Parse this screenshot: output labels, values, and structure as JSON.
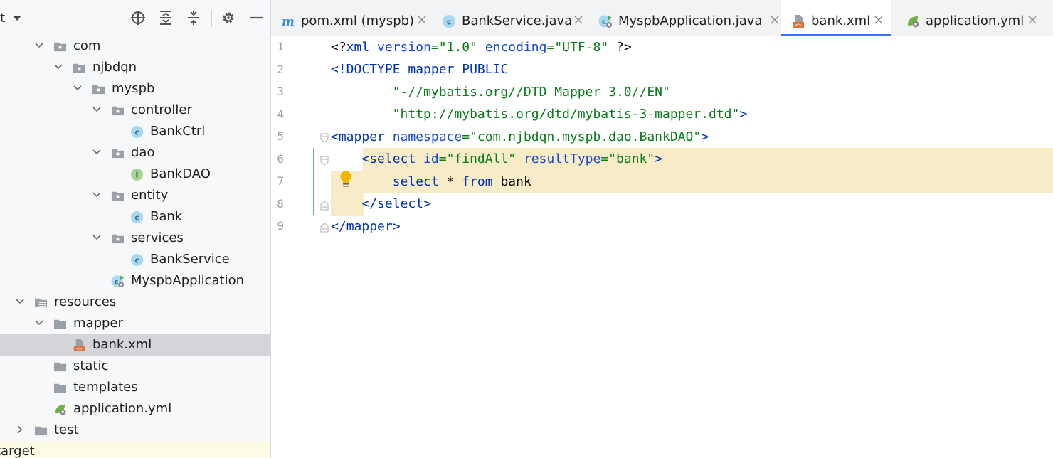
{
  "project_panel": {
    "title_fragment": "t",
    "toolbar": {
      "locate_icon": "crosshair-icon",
      "expand_icon": "expand-all-icon",
      "collapse_icon": "collapse-all-icon",
      "settings_icon": "gear-icon",
      "hide_icon": "minimize-icon"
    },
    "tree": [
      {
        "label": "com",
        "icon": "package-folder-icon"
      },
      {
        "label": "njbdqn",
        "icon": "package-folder-icon"
      },
      {
        "label": "myspb",
        "icon": "package-folder-icon"
      },
      {
        "label": "controller",
        "icon": "package-folder-icon"
      },
      {
        "label": "BankCtrl",
        "icon": "class-icon"
      },
      {
        "label": "dao",
        "icon": "package-folder-icon"
      },
      {
        "label": "BankDAO",
        "icon": "interface-icon"
      },
      {
        "label": "entity",
        "icon": "package-folder-icon"
      },
      {
        "label": "Bank",
        "icon": "class-icon"
      },
      {
        "label": "services",
        "icon": "package-folder-icon"
      },
      {
        "label": "BankService",
        "icon": "class-icon"
      },
      {
        "label": "MyspbApplication",
        "icon": "spring-boot-class-icon"
      },
      {
        "label": "resources",
        "icon": "resources-folder-icon"
      },
      {
        "label": "mapper",
        "icon": "folder-icon"
      },
      {
        "label": "bank.xml",
        "icon": "xml-file-icon"
      },
      {
        "label": "static",
        "icon": "folder-icon"
      },
      {
        "label": "templates",
        "icon": "folder-icon"
      },
      {
        "label": "application.yml",
        "icon": "spring-config-icon"
      },
      {
        "label": "test",
        "icon": "folder-icon"
      },
      {
        "label": "target",
        "icon": "folder-icon"
      }
    ]
  },
  "editor": {
    "tabs": [
      {
        "label": "pom.xml (myspb)",
        "icon": "maven-icon"
      },
      {
        "label": "BankService.java",
        "icon": "class-icon"
      },
      {
        "label": "MyspbApplication.java",
        "icon": "spring-boot-class-icon"
      },
      {
        "label": "bank.xml",
        "icon": "xml-file-icon",
        "active": true
      },
      {
        "label": "application.yml",
        "icon": "spring-config-icon"
      }
    ],
    "line_numbers": [
      "1",
      "2",
      "3",
      "4",
      "5",
      "6",
      "7",
      "8",
      "9"
    ],
    "code": {
      "l1": {
        "a": "<?",
        "b": "xml ",
        "c": "version",
        "d": "=",
        "e": "\"1.0\"",
        "f": " ",
        "g": "encoding",
        "h": "=",
        "i": "\"UTF-8\"",
        "j": " ?>"
      },
      "l2": {
        "a": "<!DOCTYPE ",
        "b": "mapper PUBLIC"
      },
      "l3": {
        "a": "        \"-//mybatis.org//DTD Mapper 3.0//EN\""
      },
      "l4": {
        "a": "        \"http://mybatis.org/dtd/mybatis-3-mapper.dtd\"",
        "b": ">"
      },
      "l5": {
        "a": "<",
        "b": "mapper ",
        "c": "namespace",
        "d": "=",
        "e": "\"com.njbdqn.myspb.dao.BankDAO\"",
        "f": ">"
      },
      "l6": {
        "a": "    <",
        "b": "select ",
        "c": "id",
        "d": "=",
        "e": "\"findAll\"",
        "f": " ",
        "g": "resultType",
        "h": "=",
        "i": "\"bank\"",
        "j": ">"
      },
      "l7": {
        "a": "        ",
        "b": "select",
        "c": " * ",
        "d": "from",
        "e": " bank"
      },
      "l8": {
        "a": "    </",
        "b": "select",
        "c": ">"
      },
      "l9": {
        "a": "</",
        "b": "mapper",
        "c": ">"
      }
    },
    "intention_icon": "lightbulb-icon",
    "colors": {
      "tag": "#0033b3",
      "string": "#067d17",
      "highlight": "#f7ebc8",
      "active_tab_underline": "#3574f0"
    }
  }
}
